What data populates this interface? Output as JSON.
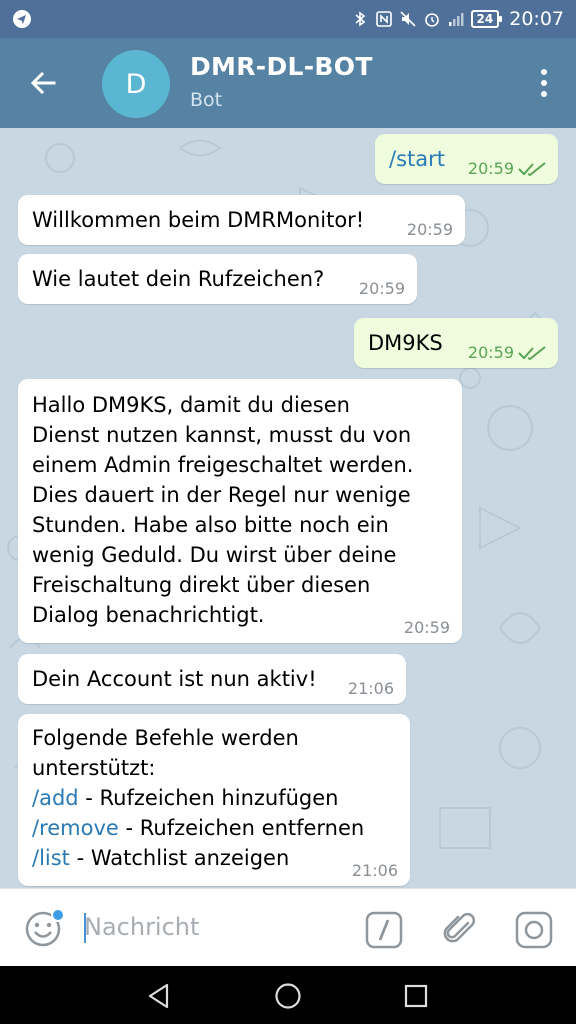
{
  "status_bar": {
    "battery": "24",
    "time": "20:07"
  },
  "header": {
    "avatar_letter": "D",
    "title": "DMR-DL-BOT",
    "subtitle": "Bot"
  },
  "messages": [
    {
      "dir": "out",
      "text": "/start",
      "is_command": true,
      "time": "20:59"
    },
    {
      "dir": "in",
      "text": "Willkommen beim DMRMonitor!",
      "time": "20:59"
    },
    {
      "dir": "in",
      "text": "Wie lautet dein Rufzeichen?",
      "time": "20:59"
    },
    {
      "dir": "out",
      "text": "DM9KS",
      "time": "20:59"
    },
    {
      "dir": "in",
      "lines": [
        "Hallo DM9KS, damit du diesen",
        "Dienst nutzen kannst, musst du von",
        "einem Admin freigeschaltet werden.",
        "Dies dauert in der Regel nur wenige",
        "Stunden. Habe also bitte noch ein",
        "wenig Geduld. Du wirst über deine",
        "Freischaltung direkt über diesen",
        "Dialog benachrichtigt."
      ],
      "time": "20:59"
    },
    {
      "dir": "in",
      "text": "Dein Account ist nun aktiv!",
      "time": "21:06"
    },
    {
      "dir": "in",
      "intro": [
        "Folgende Befehle werden",
        "unterstützt:"
      ],
      "commands": [
        {
          "cmd": "/add",
          "desc": " - Rufzeichen hinzufügen"
        },
        {
          "cmd": "/remove",
          "desc": " - Rufzeichen entfernen"
        },
        {
          "cmd": "/list",
          "desc": " - Watchlist anzeigen"
        }
      ],
      "time": "21:06"
    }
  ],
  "input": {
    "placeholder": "Nachricht"
  },
  "colors": {
    "header": "#5682a3",
    "status_bar": "#4f7199",
    "chat_bg": "#c8d7e2",
    "outgoing_bubble": "#effdde",
    "link": "#2a7ab6"
  }
}
